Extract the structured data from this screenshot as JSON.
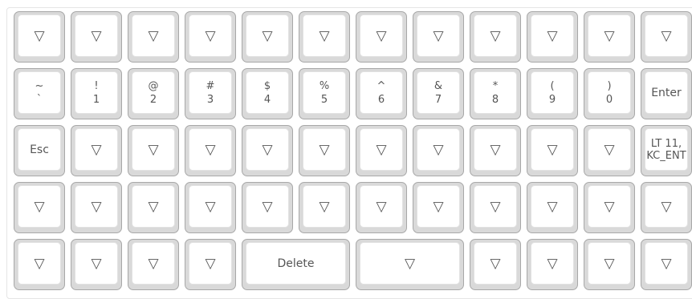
{
  "keyboard": {
    "rows": [
      [
        {
          "legend": [
            "▽"
          ]
        },
        {
          "legend": [
            "▽"
          ]
        },
        {
          "legend": [
            "▽"
          ]
        },
        {
          "legend": [
            "▽"
          ]
        },
        {
          "legend": [
            "▽"
          ]
        },
        {
          "legend": [
            "▽"
          ]
        },
        {
          "legend": [
            "▽"
          ]
        },
        {
          "legend": [
            "▽"
          ]
        },
        {
          "legend": [
            "▽"
          ]
        },
        {
          "legend": [
            "▽"
          ]
        },
        {
          "legend": [
            "▽"
          ]
        },
        {
          "legend": [
            "▽"
          ]
        }
      ],
      [
        {
          "legend": [
            "~",
            "`"
          ]
        },
        {
          "legend": [
            "!",
            "1"
          ]
        },
        {
          "legend": [
            "@",
            "2"
          ]
        },
        {
          "legend": [
            "#",
            "3"
          ]
        },
        {
          "legend": [
            "$",
            "4"
          ]
        },
        {
          "legend": [
            "%",
            "5"
          ]
        },
        {
          "legend": [
            "^",
            "6"
          ]
        },
        {
          "legend": [
            "&",
            "7"
          ]
        },
        {
          "legend": [
            "*",
            "8"
          ]
        },
        {
          "legend": [
            "(",
            "9"
          ]
        },
        {
          "legend": [
            ")",
            "0"
          ]
        },
        {
          "legend": [
            "Enter"
          ]
        }
      ],
      [
        {
          "legend": [
            "Esc"
          ]
        },
        {
          "legend": [
            "▽"
          ]
        },
        {
          "legend": [
            "▽"
          ]
        },
        {
          "legend": [
            "▽"
          ]
        },
        {
          "legend": [
            "▽"
          ]
        },
        {
          "legend": [
            "▽"
          ]
        },
        {
          "legend": [
            "▽"
          ]
        },
        {
          "legend": [
            "▽"
          ]
        },
        {
          "legend": [
            "▽"
          ]
        },
        {
          "legend": [
            "▽"
          ]
        },
        {
          "legend": [
            "▽"
          ]
        },
        {
          "legend": [
            "LT 11,",
            "KC_ENT"
          ]
        }
      ],
      [
        {
          "legend": [
            "▽"
          ]
        },
        {
          "legend": [
            "▽"
          ]
        },
        {
          "legend": [
            "▽"
          ]
        },
        {
          "legend": [
            "▽"
          ]
        },
        {
          "legend": [
            "▽"
          ]
        },
        {
          "legend": [
            "▽"
          ]
        },
        {
          "legend": [
            "▽"
          ]
        },
        {
          "legend": [
            "▽"
          ]
        },
        {
          "legend": [
            "▽"
          ]
        },
        {
          "legend": [
            "▽"
          ]
        },
        {
          "legend": [
            "▽"
          ]
        },
        {
          "legend": [
            "▽"
          ]
        }
      ],
      [
        {
          "legend": [
            "▽"
          ]
        },
        {
          "legend": [
            "▽"
          ]
        },
        {
          "legend": [
            "▽"
          ]
        },
        {
          "legend": [
            "▽"
          ]
        },
        {
          "legend": [
            "Delete"
          ],
          "wide": true
        },
        {
          "legend": [
            "▽"
          ],
          "wide": true
        },
        {
          "legend": [
            "▽"
          ]
        },
        {
          "legend": [
            "▽"
          ]
        },
        {
          "legend": [
            "▽"
          ]
        },
        {
          "legend": [
            "▽"
          ]
        }
      ]
    ]
  }
}
